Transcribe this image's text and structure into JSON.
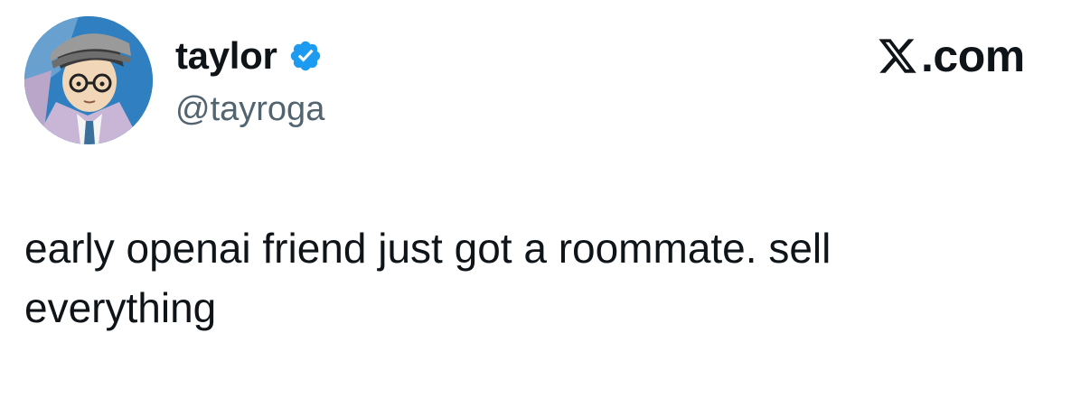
{
  "tweet": {
    "author": {
      "display_name": "taylor",
      "handle": "@tayroga",
      "verified": true,
      "verified_icon": "verified-badge-icon",
      "avatar_icon": "avatar-illustration"
    },
    "brand": {
      "logo_icon": "x-logo-icon",
      "suffix": ".com"
    },
    "text": "early openai friend just got a roommate. sell\neverything"
  },
  "colors": {
    "text_primary": "#0f1419",
    "text_secondary": "#536471",
    "verified_blue": "#1d9bf0",
    "background": "#ffffff"
  }
}
